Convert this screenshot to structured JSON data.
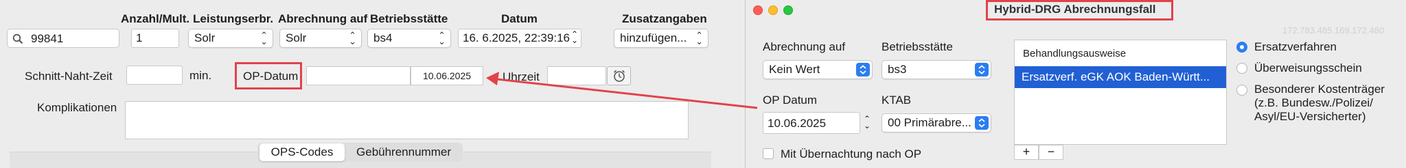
{
  "left": {
    "search_value": "99841",
    "headers": {
      "anzahl": "Anzahl/Mult.",
      "leistungserbr": "Leistungserbr.",
      "abrechnung_auf": "Abrechnung auf",
      "betriebsstaette": "Betriebsstätte",
      "datum": "Datum",
      "zusatzangaben": "Zusatzangaben"
    },
    "anzahl_value": "1",
    "leistungserbr_value": "Solr",
    "abrechnung_value": "Solr",
    "betriebsstaette_value": "bs4",
    "datum_value": "16.  6.2025, 22:39:16",
    "zusatz_value": "hinzufügen...",
    "schnitt_naht_label": "Schnitt-Naht-Zeit",
    "min_label": "min.",
    "op_datum_label": "OP-Datum",
    "op_datum_value": "10.06.2025",
    "uhrzeit_label": "Uhrzeit",
    "komplikationen_label": "Komplikationen",
    "tabs": [
      "OPS-Codes",
      "Gebührennummer"
    ]
  },
  "right": {
    "title": "Hybrid-DRG Abrechnungsfall",
    "watermark": "172.783.485.169.172.480",
    "abrechnung_auf_label": "Abrechnung auf",
    "abrechnung_auf_value": "Kein Wert",
    "betriebsstaette_label": "Betriebsstätte",
    "betriebsstaette_value": "bs3",
    "op_datum_label": "OP Datum",
    "op_datum_value": "10.06.2025",
    "ktab_label": "KTAB",
    "ktab_value": "00 Primärabre...",
    "uebernachtung_label": "Mit Übernachtung nach OP",
    "list": {
      "header": "Behandlungsausweise",
      "items": [
        "Ersatzverf. eGK AOK Baden-Württ..."
      ],
      "add": "+",
      "remove": "−"
    },
    "radios": [
      "Ersatzverfahren",
      "Überweisungsschein",
      "Besonderer Kostenträger\n(z.B. Bundesw./Polizei/\nAsyl/EU-Versicherter)"
    ]
  },
  "colors": {
    "accent": "#2a7ef0",
    "annotation_red": "#e2424a",
    "traffic_red": "#ff5f57",
    "traffic_yellow": "#febc2e",
    "traffic_green": "#28c840"
  },
  "icons": [
    "search-icon",
    "alarm-clock-icon",
    "chevron-updown-icon",
    "stepper-icon"
  ]
}
